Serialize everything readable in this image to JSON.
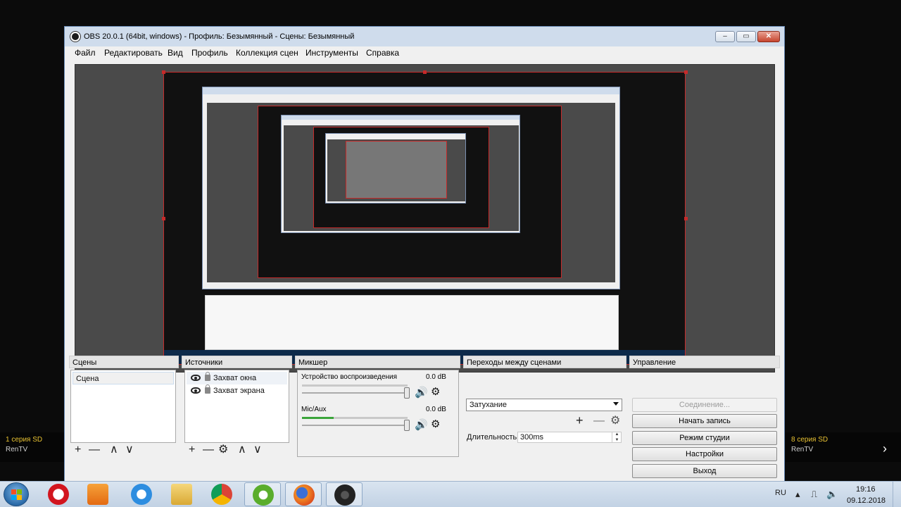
{
  "background": {
    "left_caption": {
      "line1": "1 серия SD",
      "line2": "RenTV"
    },
    "right_caption": {
      "line1": "8 серия SD",
      "line2": "RenTV"
    },
    "right_arrow": "›"
  },
  "window": {
    "title": "OBS 20.0.1 (64bit, windows) - Профиль: Безымянный - Сцены: Безымянный",
    "controls": {
      "minimize": "–",
      "maximize": "▭",
      "close": "✕"
    },
    "menu": [
      "Файл",
      "Редактировать",
      "Вид",
      "Профиль",
      "Коллекция сцен",
      "Инструменты",
      "Справка"
    ]
  },
  "docks": {
    "scenes": {
      "title": "Сцены",
      "items": [
        "Сцена"
      ]
    },
    "sources": {
      "title": "Источники",
      "items": [
        "Захват окна",
        "Захват экрана"
      ]
    },
    "mixer": {
      "title": "Микшер",
      "channels": [
        {
          "name": "Устройство воспроизведения",
          "db": "0.0 dB",
          "level": 0
        },
        {
          "name": "Mic/Aux",
          "db": "0.0 dB",
          "level": 0.3
        }
      ]
    },
    "transitions": {
      "title": "Переходы между сценами",
      "selected": "Затухание",
      "duration_label": "Длительность",
      "duration_value": "300ms"
    },
    "controls": {
      "title": "Управление",
      "buttons": [
        {
          "label": "Соединение...",
          "disabled": true
        },
        {
          "label": "Начать запись",
          "disabled": false
        },
        {
          "label": "Режим студии",
          "disabled": false
        },
        {
          "label": "Настройки",
          "disabled": false
        },
        {
          "label": "Выход",
          "disabled": false
        }
      ]
    },
    "toolbar_icons": {
      "add": "+",
      "remove": "—",
      "up": "∧",
      "down": "∨",
      "gear": "⚙"
    }
  },
  "taskbar": {
    "apps": [
      "windows-start",
      "opera",
      "media-player",
      "internet-explorer",
      "file-explorer",
      "chrome",
      "utorrent",
      "firefox",
      "obs"
    ],
    "language": "RU",
    "time": "19:16",
    "date": "09.12.2018"
  },
  "colors": {
    "selection_border": "#c62a2a",
    "caption_yellow": "#e8c232",
    "level_green": "#3ba53b"
  }
}
